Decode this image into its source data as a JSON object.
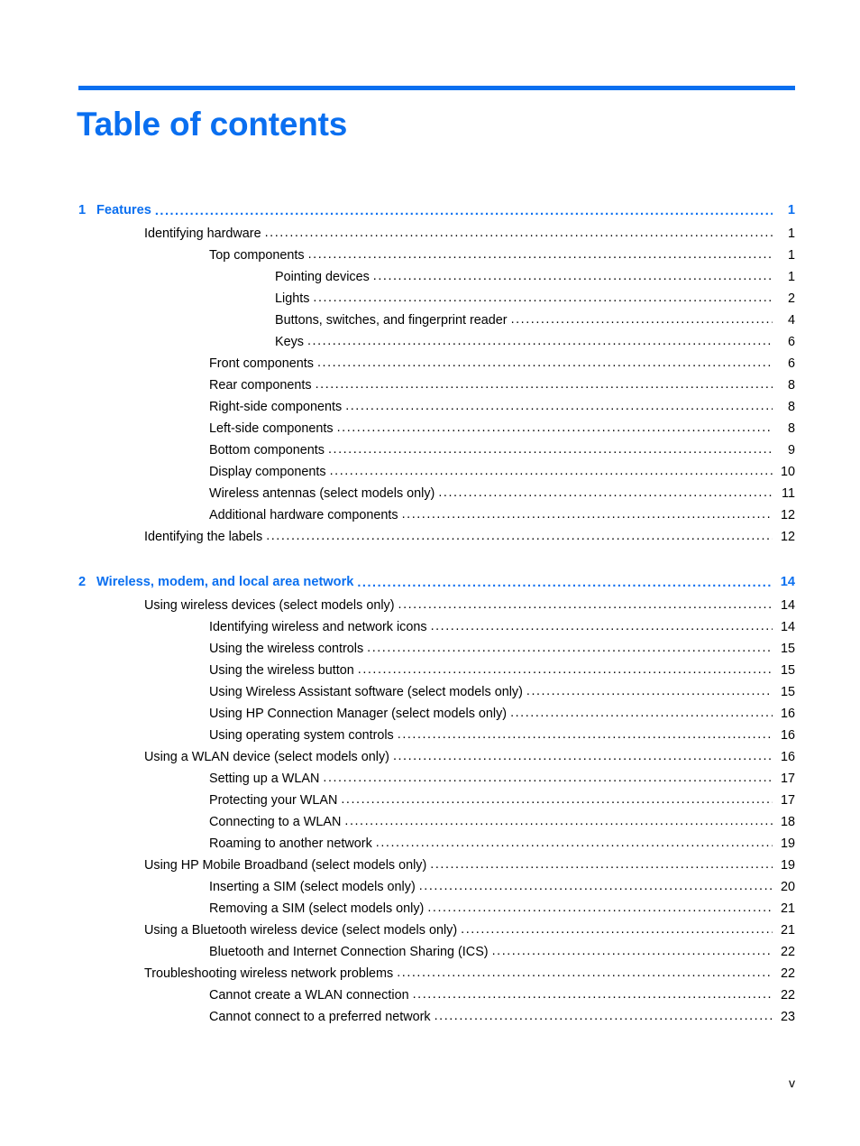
{
  "document": {
    "title": "Table of contents",
    "folio": "v",
    "accent_color": "#0a6ff0",
    "text_color": "#000000"
  },
  "toc": {
    "chapters": [
      {
        "number": "1",
        "title": "Features",
        "page": "1",
        "entries": [
          {
            "level": 1,
            "label": "Identifying hardware",
            "page": "1"
          },
          {
            "level": 2,
            "label": "Top components",
            "page": "1"
          },
          {
            "level": 3,
            "label": "Pointing devices",
            "page": "1"
          },
          {
            "level": 3,
            "label": "Lights",
            "page": "2"
          },
          {
            "level": 3,
            "label": "Buttons, switches, and fingerprint reader",
            "page": "4"
          },
          {
            "level": 3,
            "label": "Keys",
            "page": "6"
          },
          {
            "level": 2,
            "label": "Front components",
            "page": "6"
          },
          {
            "level": 2,
            "label": "Rear components",
            "page": "8"
          },
          {
            "level": 2,
            "label": "Right-side components",
            "page": "8"
          },
          {
            "level": 2,
            "label": "Left-side components",
            "page": "8"
          },
          {
            "level": 2,
            "label": "Bottom components",
            "page": "9"
          },
          {
            "level": 2,
            "label": "Display components",
            "page": "10"
          },
          {
            "level": 2,
            "label": "Wireless antennas (select models only)",
            "page": "11"
          },
          {
            "level": 2,
            "label": "Additional hardware components",
            "page": "12"
          },
          {
            "level": 1,
            "label": "Identifying the labels",
            "page": "12"
          }
        ]
      },
      {
        "number": "2",
        "title": "Wireless, modem, and local area network",
        "page": "14",
        "entries": [
          {
            "level": 1,
            "label": "Using wireless devices (select models only)",
            "page": "14"
          },
          {
            "level": 2,
            "label": "Identifying wireless and network icons",
            "page": "14"
          },
          {
            "level": 2,
            "label": "Using the wireless controls",
            "page": "15"
          },
          {
            "level": 2,
            "label": "Using the wireless button",
            "page": "15"
          },
          {
            "level": 2,
            "label": "Using Wireless Assistant software (select models only)",
            "page": "15"
          },
          {
            "level": 2,
            "label": "Using HP Connection Manager (select models only)",
            "page": "16"
          },
          {
            "level": 2,
            "label": "Using operating system controls",
            "page": "16"
          },
          {
            "level": 1,
            "label": "Using a WLAN device (select models only)",
            "page": "16"
          },
          {
            "level": 2,
            "label": "Setting up a WLAN",
            "page": "17"
          },
          {
            "level": 2,
            "label": "Protecting your WLAN",
            "page": "17"
          },
          {
            "level": 2,
            "label": "Connecting to a WLAN",
            "page": "18"
          },
          {
            "level": 2,
            "label": "Roaming to another network",
            "page": "19"
          },
          {
            "level": 1,
            "label": "Using HP Mobile Broadband (select models only)",
            "page": "19"
          },
          {
            "level": 2,
            "label": "Inserting a SIM (select models only)",
            "page": "20"
          },
          {
            "level": 2,
            "label": "Removing a SIM (select models only)",
            "page": "21"
          },
          {
            "level": 1,
            "label": "Using a Bluetooth wireless device (select models only)",
            "page": "21"
          },
          {
            "level": 2,
            "label": "Bluetooth and Internet Connection Sharing (ICS)",
            "page": "22"
          },
          {
            "level": 1,
            "label": "Troubleshooting wireless network problems",
            "page": "22"
          },
          {
            "level": 2,
            "label": "Cannot create a WLAN connection",
            "page": "22"
          },
          {
            "level": 2,
            "label": "Cannot connect to a preferred network",
            "page": "23"
          }
        ]
      }
    ]
  }
}
